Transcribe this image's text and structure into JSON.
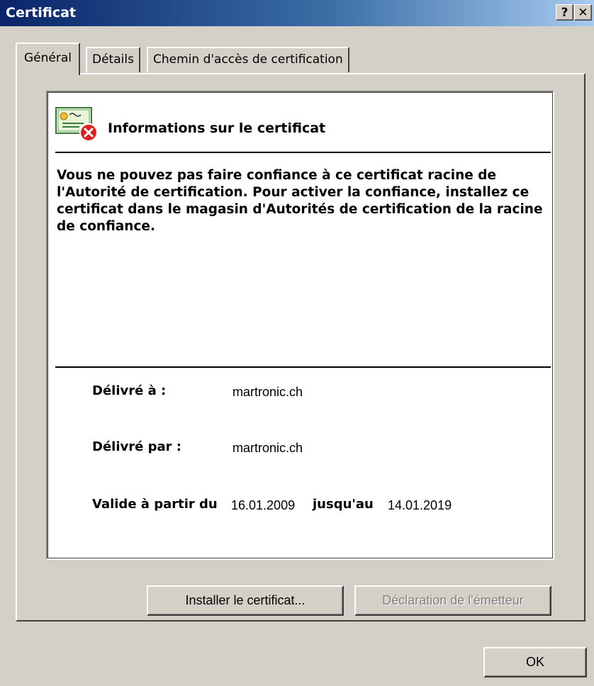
{
  "window": {
    "title": "Certificat",
    "help_label": "?",
    "close_label": "✕"
  },
  "tabs": [
    {
      "label": "Général",
      "active": true
    },
    {
      "label": "Détails",
      "active": false
    },
    {
      "label": "Chemin d'accès de certification",
      "active": false
    }
  ],
  "info": {
    "icon": "certificate-error-icon",
    "title": "Informations sur le certificat",
    "message": "Vous ne pouvez pas faire confiance à ce certificat racine de l'Autorité de certification. Pour activer la confiance, installez ce certificat dans le magasin d'Autorités de certification de la racine de confiance."
  },
  "details": {
    "issued_to_label": "Délivré à :",
    "issued_to": "martronic.ch",
    "issued_by_label": "Délivré par :",
    "issued_by": "martronic.ch",
    "valid_from_label": "Valide à partir du",
    "valid_from": "16.01.2009",
    "valid_to_label": "jusqu'au",
    "valid_to": "14.01.2019"
  },
  "buttons": {
    "install": "Installer le certificat...",
    "issuer_statement": "Déclaration de l'émetteur",
    "ok": "OK"
  },
  "colors": {
    "titlebar_start": "#0a246a",
    "titlebar_end": "#a6caf0",
    "dialog_bg": "#d4d0c8",
    "error_red": "#e02020"
  }
}
